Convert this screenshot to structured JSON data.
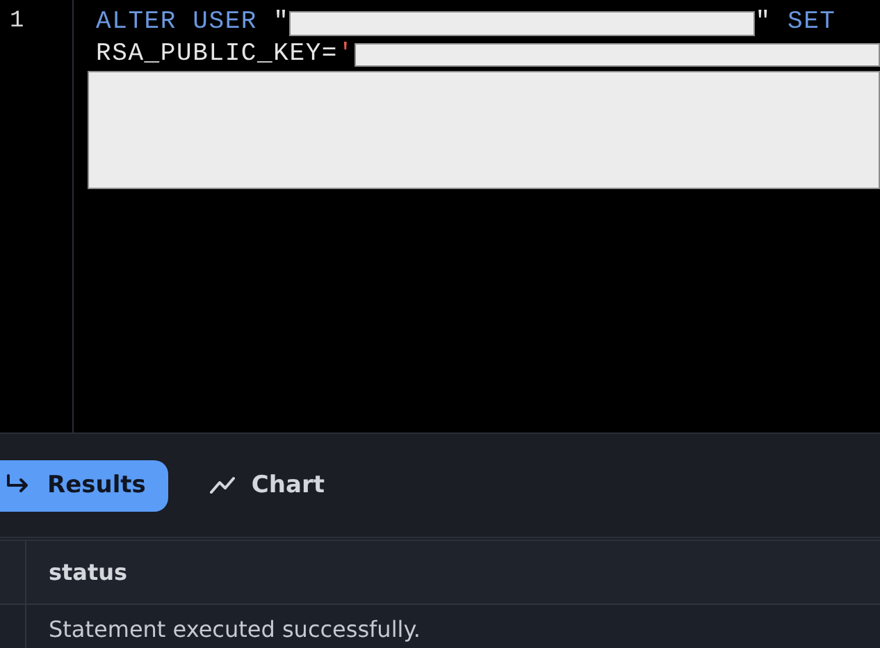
{
  "editor": {
    "line_numbers": [
      "1"
    ],
    "tokens": [
      {
        "kind": "keyword",
        "text": "ALTER USER"
      },
      {
        "kind": "text",
        "text": " \""
      },
      {
        "kind": "redacted_inline"
      },
      {
        "kind": "text",
        "text": "\" "
      },
      {
        "kind": "keyword",
        "text": "SET"
      },
      {
        "kind": "text",
        "text": "RSA_PUBLIC_KEY="
      },
      {
        "kind": "string",
        "text": "'"
      },
      {
        "kind": "redacted_line"
      },
      {
        "kind": "redacted_block"
      }
    ]
  },
  "tabs": [
    {
      "label": "Results",
      "kind": "return",
      "selected": true
    },
    {
      "label": "Chart",
      "kind": "line",
      "selected": false
    }
  ],
  "table": {
    "columns": [
      "status"
    ],
    "rows": [
      [
        "Statement executed successfully."
      ]
    ]
  }
}
